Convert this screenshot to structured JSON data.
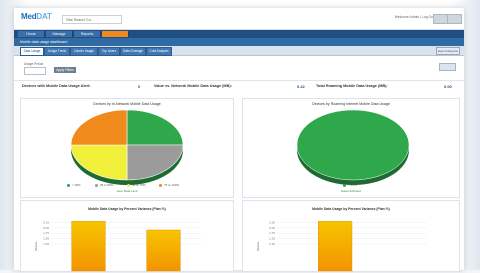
{
  "app": {
    "logo_main": "Med",
    "logo_accent": "DAT",
    "company_selector": "Site Brand Co."
  },
  "header": {
    "user_info": "Welcome Admin | Log Out"
  },
  "nav": {
    "tabs": [
      {
        "label": "Home",
        "active": false
      },
      {
        "label": "Manage",
        "active": false
      },
      {
        "label": "Reports",
        "active": false
      },
      {
        "label": "",
        "active": true
      }
    ]
  },
  "subnav": {
    "title": "Mobile data usage dashboard"
  },
  "subtabs": {
    "items": [
      {
        "label": "Data Usage",
        "active": true
      },
      {
        "label": "Usage Trend",
        "active": false
      },
      {
        "label": "Carrier Usage",
        "active": false
      },
      {
        "label": "Top Users",
        "active": false
      },
      {
        "label": "Data Overage",
        "active": false
      },
      {
        "label": "Cost Analysis",
        "active": false
      }
    ],
    "export_label": "Export Reports"
  },
  "filter": {
    "label": "Usage Period",
    "apply_label": "Apply Filters"
  },
  "stats": [
    {
      "label": "Devices with Mobile Data Usage Alert:",
      "value": "0"
    },
    {
      "label": "Value vs. Network Mobile Data Usage (MB):",
      "value": "0.22"
    },
    {
      "label": "Total Roaming Mobile Data Usage (MB):",
      "value": "0.00"
    }
  ],
  "pie_left": {
    "title": "Devices by In-Network Mobile Data Usage",
    "legend": [
      {
        "label": "< 25%",
        "color": "#2ea84b"
      },
      {
        "label": "25 to 50%",
        "color": "#9b9b9b"
      },
      {
        "label": "50 to 75%",
        "color": "#f0ef3a"
      },
      {
        "label": "75 to 100%",
        "color": "#f08a1c"
      }
    ],
    "sublabel": "Over Data Limit",
    "chart_data": {
      "type": "pie",
      "slices": [
        {
          "label": "< 25%",
          "value": 25,
          "color": "#2ea84b"
        },
        {
          "label": "25 to 50%",
          "value": 25,
          "color": "#9b9b9b"
        },
        {
          "label": "50 to 75%",
          "value": 25,
          "color": "#f0ef3a"
        },
        {
          "label": "75 to 100%",
          "value": 25,
          "color": "#f08a1c"
        }
      ]
    }
  },
  "pie_right": {
    "title": "Devices by Roaming Internet Mobile Data Usage",
    "legend": [
      {
        "label": "< 25%",
        "color": "#2ea84b"
      }
    ],
    "sublabel": "Data Unlimited",
    "chart_data": {
      "type": "pie",
      "slices": [
        {
          "label": "< 25%",
          "value": 100,
          "color": "#2ea84b"
        }
      ]
    }
  },
  "bar_left": {
    "title": "Mobile Data Usage by Percent Variance (Plan %)",
    "ylabel": "Devices",
    "chart_data": {
      "type": "bar",
      "categories": [
        "A",
        "B"
      ],
      "values": [
        2.3,
        1.9
      ],
      "ylim": [
        0,
        2.5
      ],
      "yticks": [
        "2.25",
        "2.00",
        "1.75",
        "1.50",
        "1.25"
      ]
    }
  },
  "bar_right": {
    "title": "Mobile Data Usage by Percent Variance (Plan %)",
    "ylabel": "Devices",
    "chart_data": {
      "type": "bar",
      "categories": [
        "A"
      ],
      "values": [
        2.3
      ],
      "ylim": [
        0,
        2.5
      ],
      "yticks": [
        "2.25",
        "2.00",
        "1.75",
        "1.50",
        "1.25"
      ]
    }
  },
  "colors": {
    "nav_dark": "#1f4e84",
    "accent_orange": "#f08a1c",
    "bar_top": "#f7c400",
    "bar_bottom": "#f39400"
  }
}
